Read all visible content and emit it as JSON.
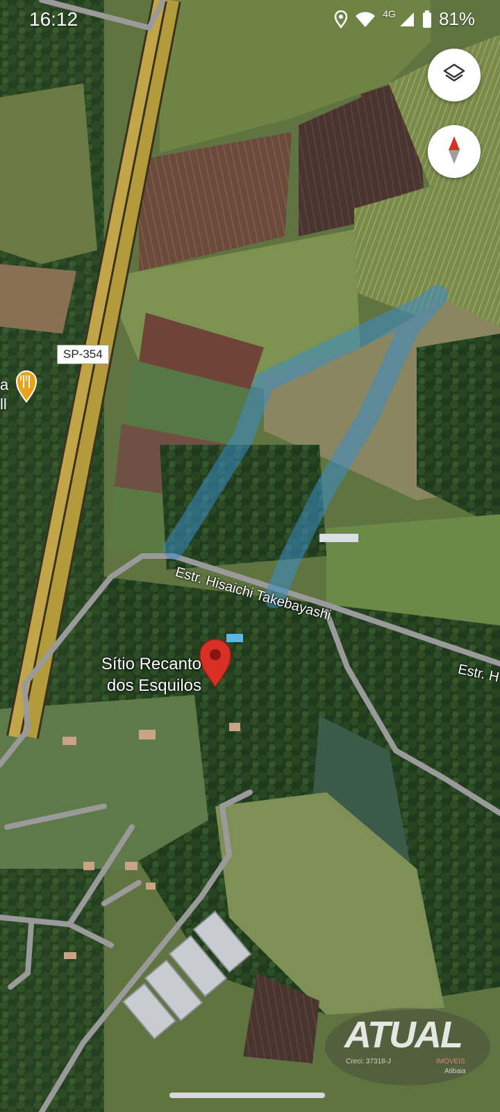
{
  "status_bar": {
    "time": "16:12",
    "network": "4G",
    "battery": "81%"
  },
  "map": {
    "road_shield": "SP-354",
    "place_name_line1": "Sítio Recanto",
    "place_name_line2": "dos Esquilos",
    "poi_partial_line1": "a",
    "poi_partial_line2": "ll",
    "street_1": "Estr. Hisaichi Takebayashi",
    "street_2": "Estr. H",
    "colors": {
      "boundary_fill": "#3a8cc8",
      "pin": "#d93025",
      "poi_pin": "#e8a319",
      "highway": "#b39a3a"
    }
  },
  "controls": {
    "layers_icon": "layers-icon",
    "compass_icon": "compass-icon"
  },
  "watermark": {
    "brand": "ATUAL",
    "creci": "Creci: 37318-J",
    "line2": "IMÓVEIS",
    "line3": "Atibaia"
  }
}
